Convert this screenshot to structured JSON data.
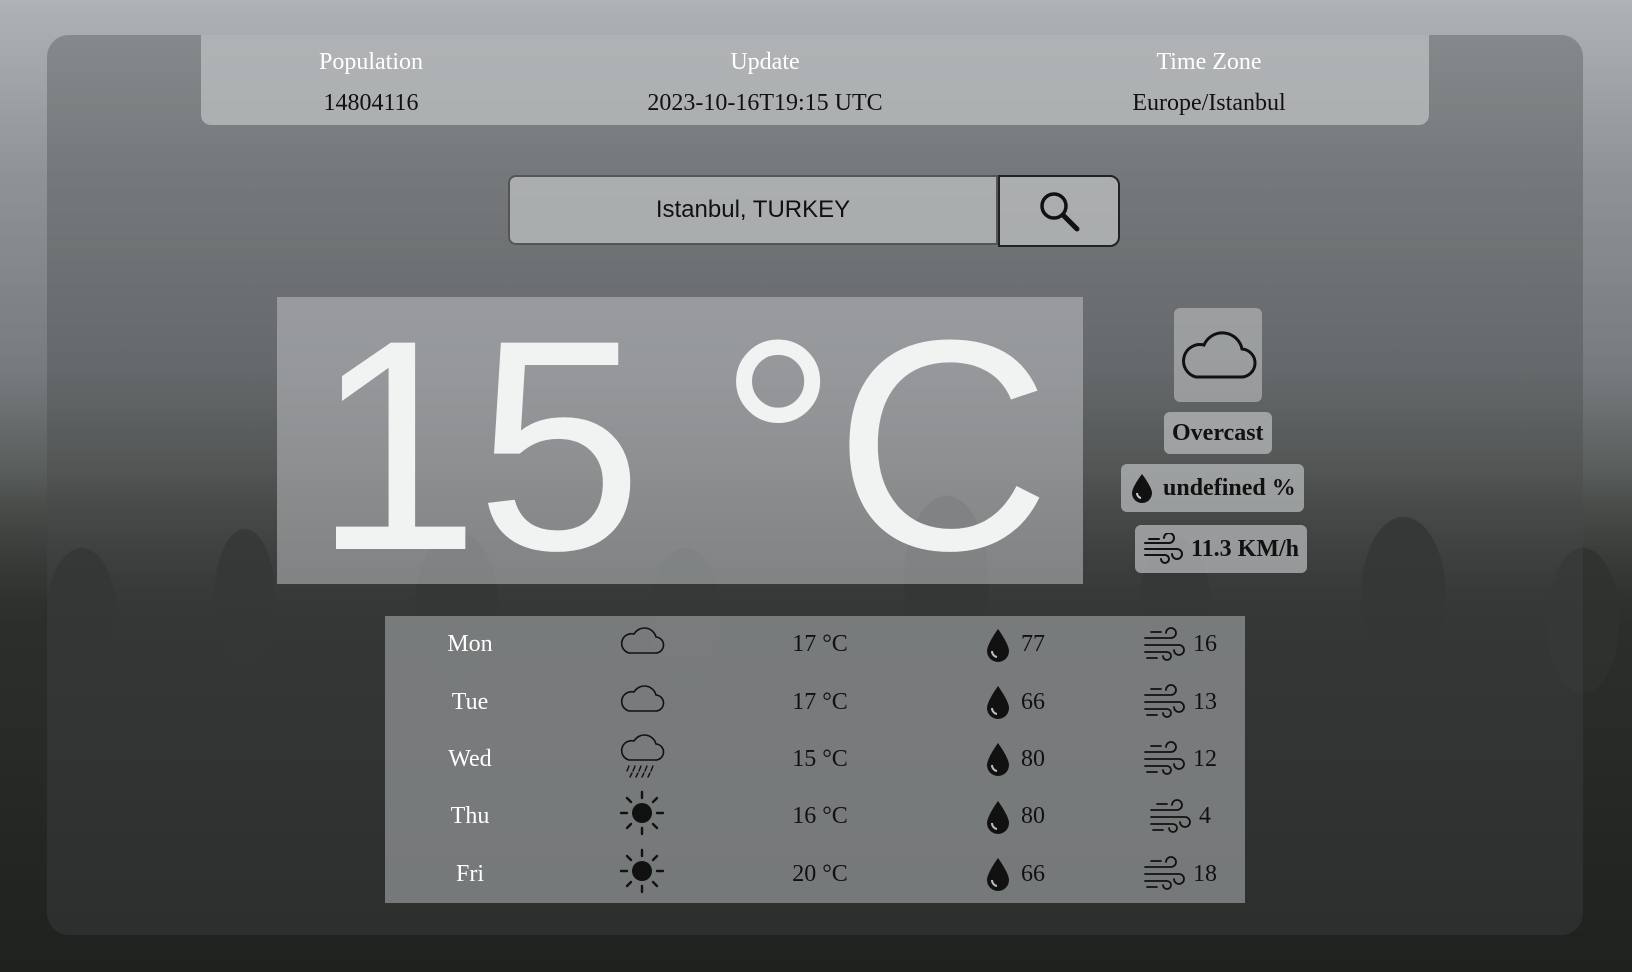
{
  "info": {
    "population_label": "Population",
    "population_value": "14804116",
    "update_label": "Update",
    "update_value": "2023-10-16T19:15 UTC",
    "timezone_label": "Time Zone",
    "timezone_value": "Europe/Istanbul"
  },
  "search": {
    "value": "Istanbul, TURKEY",
    "button_icon": "search-icon"
  },
  "current": {
    "temperature": "15 °C",
    "condition_icon": "cloud-icon",
    "condition": "Overcast",
    "humidity": "undefined %",
    "wind": "11.3 KM/h"
  },
  "forecast": [
    {
      "day": "Mon",
      "icon": "cloud-icon",
      "temp": "17 °C",
      "humidity": "77",
      "wind": "16"
    },
    {
      "day": "Tue",
      "icon": "cloud-icon",
      "temp": "17 °C",
      "humidity": "66",
      "wind": "13"
    },
    {
      "day": "Wed",
      "icon": "rain-icon",
      "temp": "15 °C",
      "humidity": "80",
      "wind": "12"
    },
    {
      "day": "Thu",
      "icon": "sun-icon",
      "temp": "16 °C",
      "humidity": "80",
      "wind": "4"
    },
    {
      "day": "Fri",
      "icon": "sun-icon",
      "temp": "20 °C",
      "humidity": "66",
      "wind": "18"
    }
  ]
}
